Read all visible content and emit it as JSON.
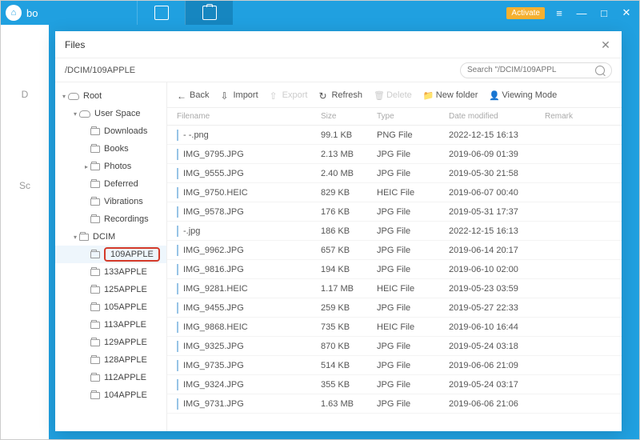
{
  "titlebar": {
    "app_name": "bo",
    "activate": "Activate"
  },
  "leftstrip": {
    "item1": "D",
    "item2": "Sc"
  },
  "dialog": {
    "title": "Files",
    "path": "/DCIM/109APPLE",
    "search_placeholder": "Search \"/DCIM/109APPL"
  },
  "toolbar": {
    "back": "Back",
    "import": "Import",
    "export": "Export",
    "refresh": "Refresh",
    "delete": "Delete",
    "newfolder": "New folder",
    "viewmode": "Viewing Mode"
  },
  "tree": [
    {
      "label": "Root",
      "depth": 0,
      "caret": "▾",
      "icon": "cloud"
    },
    {
      "label": "User Space",
      "depth": 1,
      "caret": "▾",
      "icon": "cloud"
    },
    {
      "label": "Downloads",
      "depth": 2,
      "caret": "",
      "icon": "folder"
    },
    {
      "label": "Books",
      "depth": 2,
      "caret": "",
      "icon": "folder"
    },
    {
      "label": "Photos",
      "depth": 2,
      "caret": "▸",
      "icon": "folder"
    },
    {
      "label": "Deferred",
      "depth": 2,
      "caret": "",
      "icon": "folder"
    },
    {
      "label": "Vibrations",
      "depth": 2,
      "caret": "",
      "icon": "folder"
    },
    {
      "label": "Recordings",
      "depth": 2,
      "caret": "",
      "icon": "folder"
    },
    {
      "label": "DCIM",
      "depth": 1,
      "caret": "▾",
      "icon": "folder"
    },
    {
      "label": "109APPLE",
      "depth": 2,
      "caret": "",
      "icon": "folder",
      "selected": true
    },
    {
      "label": "133APPLE",
      "depth": 2,
      "caret": "",
      "icon": "folder"
    },
    {
      "label": "125APPLE",
      "depth": 2,
      "caret": "",
      "icon": "folder"
    },
    {
      "label": "105APPLE",
      "depth": 2,
      "caret": "",
      "icon": "folder"
    },
    {
      "label": "113APPLE",
      "depth": 2,
      "caret": "",
      "icon": "folder"
    },
    {
      "label": "129APPLE",
      "depth": 2,
      "caret": "",
      "icon": "folder"
    },
    {
      "label": "128APPLE",
      "depth": 2,
      "caret": "",
      "icon": "folder"
    },
    {
      "label": "112APPLE",
      "depth": 2,
      "caret": "",
      "icon": "folder"
    },
    {
      "label": "104APPLE",
      "depth": 2,
      "caret": "",
      "icon": "folder"
    }
  ],
  "columns": {
    "name": "Filename",
    "size": "Size",
    "type": "Type",
    "date": "Date modified",
    "remark": "Remark"
  },
  "files": [
    {
      "name": "- -.png",
      "size": "99.1 KB",
      "type": "PNG File",
      "date": "2022-12-15 16:13"
    },
    {
      "name": "IMG_9795.JPG",
      "size": "2.13 MB",
      "type": "JPG File",
      "date": "2019-06-09 01:39"
    },
    {
      "name": "IMG_9555.JPG",
      "size": "2.40 MB",
      "type": "JPG File",
      "date": "2019-05-30 21:58"
    },
    {
      "name": "IMG_9750.HEIC",
      "size": "829 KB",
      "type": "HEIC File",
      "date": "2019-06-07 00:40"
    },
    {
      "name": "IMG_9578.JPG",
      "size": "176 KB",
      "type": "JPG File",
      "date": "2019-05-31 17:37"
    },
    {
      "name": "-.jpg",
      "size": "186 KB",
      "type": "JPG File",
      "date": "2022-12-15 16:13"
    },
    {
      "name": "IMG_9962.JPG",
      "size": "657 KB",
      "type": "JPG File",
      "date": "2019-06-14 20:17"
    },
    {
      "name": "IMG_9816.JPG",
      "size": "194 KB",
      "type": "JPG File",
      "date": "2019-06-10 02:00"
    },
    {
      "name": "IMG_9281.HEIC",
      "size": "1.17 MB",
      "type": "HEIC File",
      "date": "2019-05-23 03:59"
    },
    {
      "name": "IMG_9455.JPG",
      "size": "259 KB",
      "type": "JPG File",
      "date": "2019-05-27 22:33"
    },
    {
      "name": "IMG_9868.HEIC",
      "size": "735 KB",
      "type": "HEIC File",
      "date": "2019-06-10 16:44"
    },
    {
      "name": "IMG_9325.JPG",
      "size": "870 KB",
      "type": "JPG File",
      "date": "2019-05-24 03:18"
    },
    {
      "name": "IMG_9735.JPG",
      "size": "514 KB",
      "type": "JPG File",
      "date": "2019-06-06 21:09"
    },
    {
      "name": "IMG_9324.JPG",
      "size": "355 KB",
      "type": "JPG File",
      "date": "2019-05-24 03:17"
    },
    {
      "name": "IMG_9731.JPG",
      "size": "1.63 MB",
      "type": "JPG File",
      "date": "2019-06-06 21:06"
    }
  ]
}
